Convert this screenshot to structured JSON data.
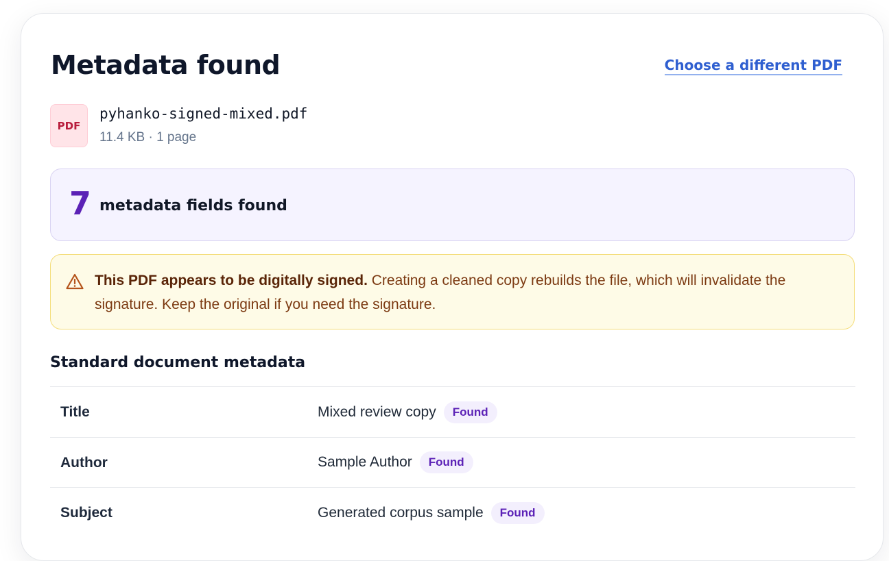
{
  "header": {
    "title": "Metadata found",
    "choose_link": "Choose a different PDF"
  },
  "file": {
    "icon_label": "PDF",
    "name": "pyhanko-signed-mixed.pdf",
    "meta": "11.4 KB · 1 page"
  },
  "summary": {
    "count": "7",
    "label": "metadata fields found"
  },
  "warning": {
    "icon": "warning-triangle-icon",
    "strong": "This PDF appears to be digitally signed.",
    "text": " Creating a cleaned copy rebuilds the file, which will invalidate the signature. Keep the original if you need the signature."
  },
  "section": {
    "title": "Standard document metadata"
  },
  "rows": [
    {
      "key": "Title",
      "value": "Mixed review copy",
      "badge": "Found"
    },
    {
      "key": "Author",
      "value": "Sample Author",
      "badge": "Found"
    },
    {
      "key": "Subject",
      "value": "Generated corpus sample",
      "badge": "Found"
    }
  ],
  "colors": {
    "accent": "#5b21b6",
    "link": "#2f5fd0",
    "warning_border": "#f4dd79",
    "warning_bg": "#fefbe7"
  }
}
